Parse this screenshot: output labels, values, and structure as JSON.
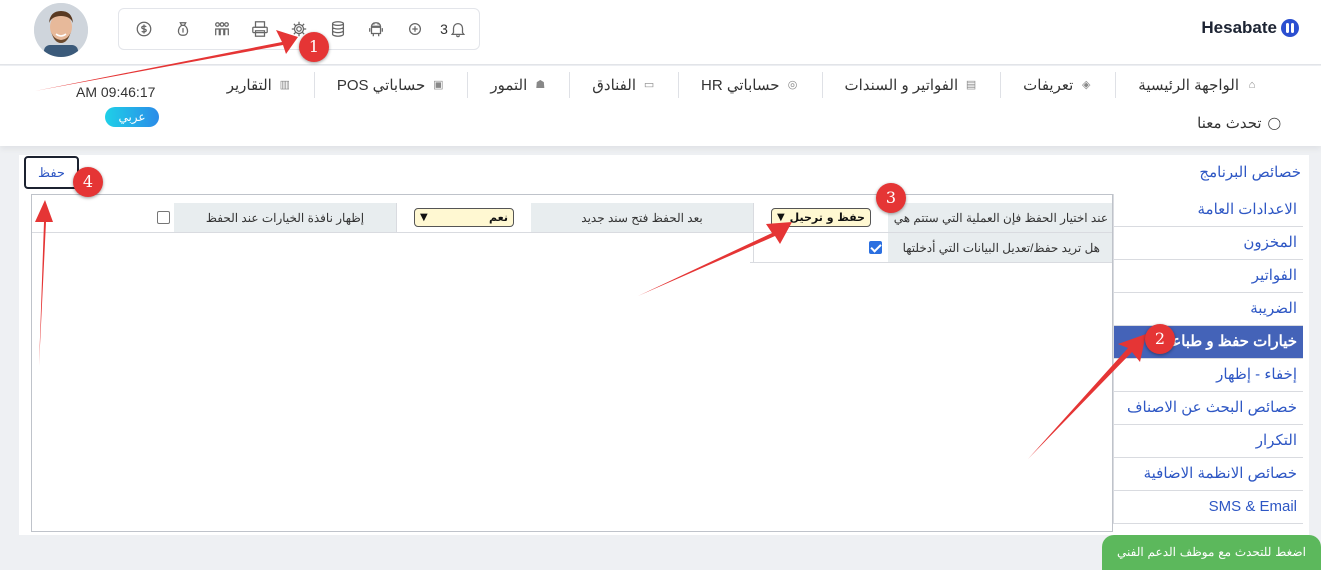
{
  "brand": {
    "name": "Hesabate"
  },
  "topbar": {
    "notification_count": "3",
    "icons": [
      "dollar-coin-icon",
      "money-bag-icon",
      "users-group-icon",
      "printer-icon",
      "gear-icon",
      "database-icon",
      "android-icon",
      "plus-circle-icon",
      "bell-icon"
    ]
  },
  "clock": {
    "time": "AM 09:46:17"
  },
  "language": {
    "label": "عربي"
  },
  "nav": {
    "items": [
      {
        "label": "الواجهة الرئيسية",
        "icon": "home-icon"
      },
      {
        "label": "تعريفات",
        "icon": "layers-icon"
      },
      {
        "label": "الفواتير و السندات",
        "icon": "invoice-icon"
      },
      {
        "label": "حساباتي HR",
        "icon": "target-icon"
      },
      {
        "label": "الفنادق",
        "icon": "hotel-icon"
      },
      {
        "label": "التمور",
        "icon": "dates-icon"
      },
      {
        "label": "حساباتي POS",
        "icon": "pos-icon"
      },
      {
        "label": "التقارير",
        "icon": "bank-icon"
      }
    ],
    "chat": {
      "label": "تحدث معنا",
      "icon": "chat-icon"
    }
  },
  "panel": {
    "title": "خصائص البرنامج",
    "save_label": "حفظ"
  },
  "sidebar": {
    "items": [
      {
        "label": "الاعدادات العامة",
        "active": false
      },
      {
        "label": "المخزون",
        "active": false
      },
      {
        "label": "الفواتير",
        "active": false
      },
      {
        "label": "الضريبة",
        "active": false
      },
      {
        "label": "خيارات حفظ و طباعة",
        "active": true
      },
      {
        "label": "إخفاء - إظهار",
        "active": false
      },
      {
        "label": "خصائص البحث عن الاصناف",
        "active": false
      },
      {
        "label": "التكرار",
        "active": false
      },
      {
        "label": "خصائص الانظمة الاضافية",
        "active": false
      },
      {
        "label": "SMS & Email",
        "active": false
      }
    ]
  },
  "settings": {
    "save_operation": {
      "label": "عند اختيار الحفظ فإن العملية التي ستتم هي",
      "value": "حفظ و ترحيل"
    },
    "open_new_after_save": {
      "label": "بعد الحفظ فتح سند جديد",
      "value": "نعم"
    },
    "show_options_window": {
      "label": "إظهار نافذة الخيارات عند الحفظ",
      "checked": false
    },
    "confirm_save": {
      "label": "هل تريد حفظ/تعديل البيانات التي أدخلتها",
      "checked": true
    }
  },
  "support": {
    "label": "اضغط للتحدث مع موظف الدعم الفني"
  },
  "annotations": {
    "badges": [
      "1",
      "2",
      "3",
      "4"
    ],
    "color": "#e53535"
  },
  "colors": {
    "accent": "#2e57c4",
    "active_tab": "#4463b8",
    "support": "#5cb85c",
    "label_bg": "#e8edef"
  }
}
